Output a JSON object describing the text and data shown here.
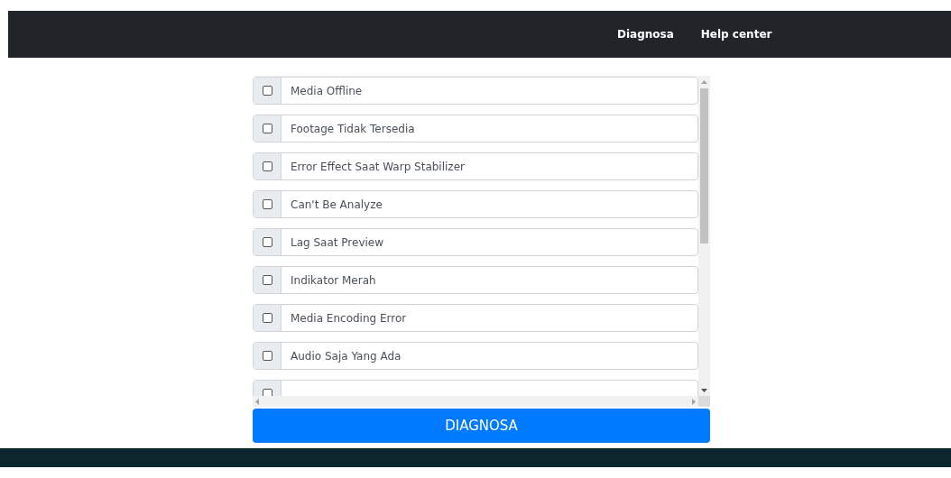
{
  "navbar": {
    "links": [
      {
        "label": "Diagnosa"
      },
      {
        "label": "Help center"
      }
    ]
  },
  "symptoms": [
    {
      "label": "Media Offline",
      "checked": false
    },
    {
      "label": "Footage Tidak Tersedia",
      "checked": false
    },
    {
      "label": "Error Effect Saat Warp Stabilizer",
      "checked": false
    },
    {
      "label": "Can't Be Analyze",
      "checked": false
    },
    {
      "label": "Lag Saat Preview",
      "checked": false
    },
    {
      "label": "Indikator Merah",
      "checked": false
    },
    {
      "label": "Media Encoding Error",
      "checked": false
    },
    {
      "label": "Audio Saja Yang Ada",
      "checked": false
    },
    {
      "checked": false
    }
  ],
  "submit_button": {
    "label": "DIAGNOSA"
  }
}
